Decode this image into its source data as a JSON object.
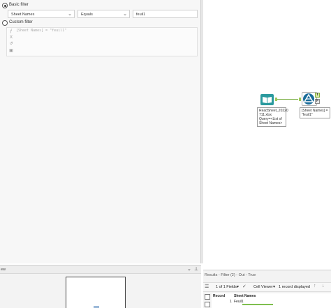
{
  "config": {
    "basic_filter_label": "Basic filter",
    "field_select": "Sheet Names",
    "operator_select": "Equals",
    "value_input": "feuil1",
    "custom_filter_label": "Custom filter",
    "expression_text": "[Sheet Names] = \"feuil1\""
  },
  "overview": {
    "title": "ew"
  },
  "canvas": {
    "input_tool_text": [
      "ReadSheet_20220",
      "711.xlsx",
      "Query=<List of",
      "Sheet Names>"
    ],
    "filter_tool_text": [
      "[Sheet Names] =",
      "\"feuil1\""
    ],
    "true_label": "T",
    "false_label": "F"
  },
  "results": {
    "title": "Results - Filter (2) - Out - True",
    "fields_label": "1 of 1 Fields",
    "cell_viewer_label": "Cell Viewer",
    "records_label": "1 record displayed",
    "columns": [
      "Record",
      "Sheet Names"
    ],
    "rows": [
      {
        "record": "1",
        "sheet_name": "Feuil1"
      }
    ]
  },
  "colors": {
    "accent": "#1a6c9a",
    "connector": "#7fb24a",
    "input_tool": "#2a9a9e",
    "filter_tool": "#1a6c9a"
  }
}
